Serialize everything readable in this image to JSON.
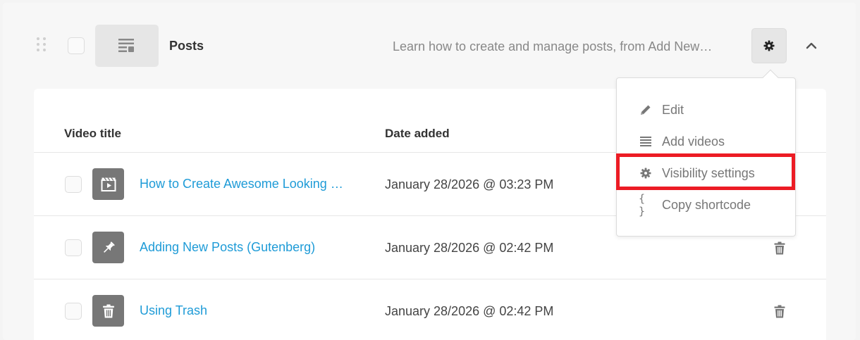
{
  "folder": {
    "title": "Posts",
    "description": "Learn how to create and manage posts, from Add New…"
  },
  "table": {
    "col_title": "Video title",
    "col_date": "Date added",
    "rows": [
      {
        "title": "How to Create Awesome Looking …",
        "date": "January 28/2026 @ 03:23 PM",
        "icon": "video-clapper-icon"
      },
      {
        "title": "Adding New Posts (Gutenberg)",
        "date": "January 28/2026 @ 02:42 PM",
        "icon": "pin-icon"
      },
      {
        "title": "Using Trash",
        "date": "January 28/2026 @ 02:42 PM",
        "icon": "trash-icon"
      }
    ]
  },
  "menu": {
    "items": [
      {
        "label": "Edit",
        "icon": "pencil-icon"
      },
      {
        "label": "Add videos",
        "icon": "list-icon"
      },
      {
        "label": "Visibility settings",
        "icon": "gear-icon"
      },
      {
        "label": "Copy shortcode",
        "icon": "braces-icon"
      }
    ],
    "highlighted": "Visibility settings"
  },
  "colors": {
    "link": "#1e9bd7",
    "highlight": "#ec1c24",
    "thumb": "#777777"
  }
}
